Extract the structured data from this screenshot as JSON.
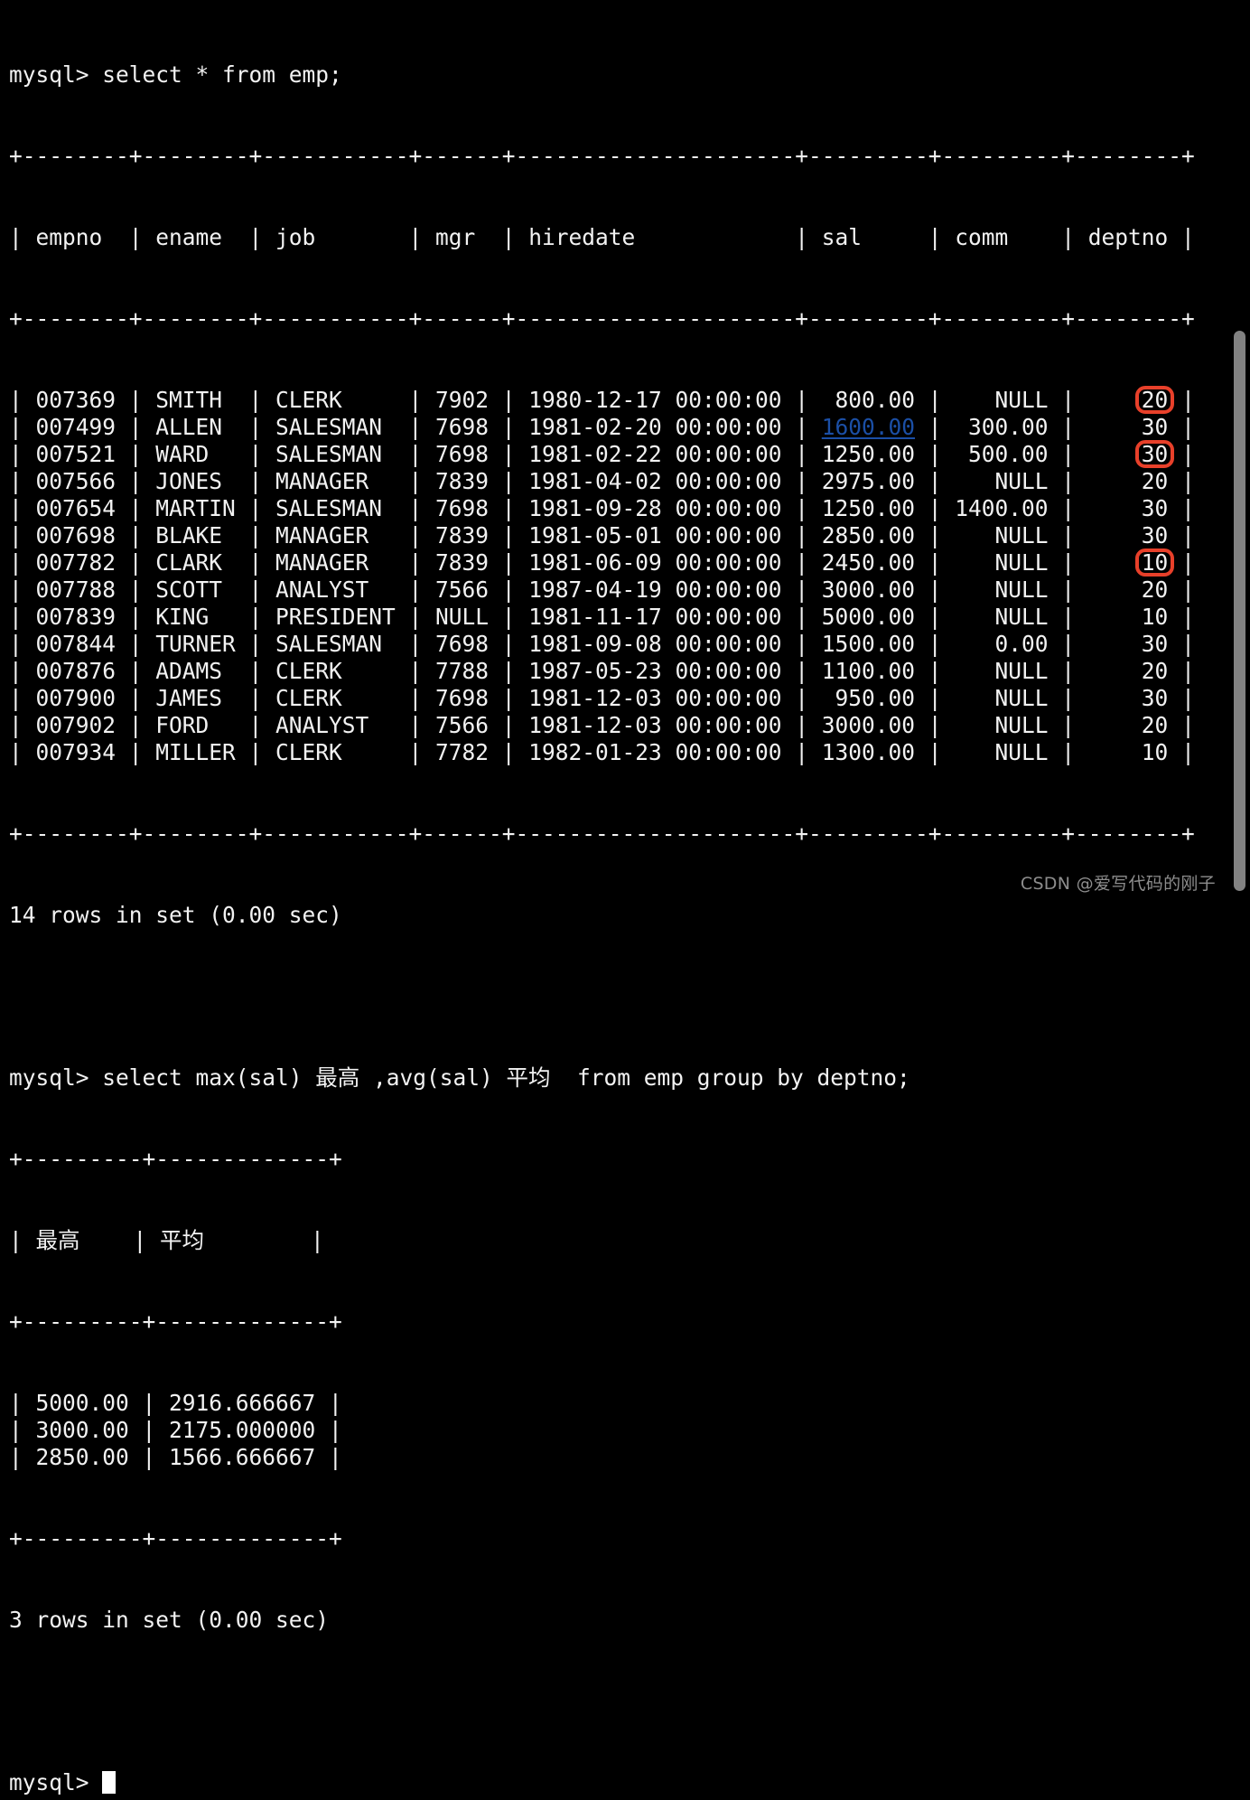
{
  "terminal": {
    "prompt": "mysql>",
    "background_color": "#000000",
    "foreground_color": "#f2f2f2",
    "highlight_color": "#e8402a",
    "link_color": "#1b4fa6",
    "scrollbar_color": "#828282"
  },
  "command_1": "mysql> select * from emp;",
  "table_1": {
    "separator": "+--------+--------+-----------+------+---------------------+---------+---------+--------+",
    "headers": [
      "empno",
      "ename",
      "job",
      "mgr",
      "hiredate",
      "sal",
      "comm",
      "deptno"
    ],
    "header_line": "| empno  | ename  | job       | mgr  | hiredate            | sal     | comm    | deptno |",
    "rows": [
      {
        "empno": "007369",
        "ename": "SMITH",
        "job": "CLERK",
        "mgr": "7902",
        "hiredate": "1980-12-17 00:00:00",
        "sal": " 800.00",
        "comm": "   NULL",
        "deptno": "20",
        "sal_link": false,
        "deptno_boxed": true
      },
      {
        "empno": "007499",
        "ename": "ALLEN",
        "job": "SALESMAN",
        "mgr": "7698",
        "hiredate": "1981-02-20 00:00:00",
        "sal": "1600.00",
        "comm": " 300.00",
        "deptno": "30",
        "sal_link": true,
        "deptno_boxed": false
      },
      {
        "empno": "007521",
        "ename": "WARD",
        "job": "SALESMAN",
        "mgr": "7698",
        "hiredate": "1981-02-22 00:00:00",
        "sal": "1250.00",
        "comm": " 500.00",
        "deptno": "30",
        "sal_link": false,
        "deptno_boxed": true
      },
      {
        "empno": "007566",
        "ename": "JONES",
        "job": "MANAGER",
        "mgr": "7839",
        "hiredate": "1981-04-02 00:00:00",
        "sal": "2975.00",
        "comm": "   NULL",
        "deptno": "20",
        "sal_link": false,
        "deptno_boxed": false
      },
      {
        "empno": "007654",
        "ename": "MARTIN",
        "job": "SALESMAN",
        "mgr": "7698",
        "hiredate": "1981-09-28 00:00:00",
        "sal": "1250.00",
        "comm": "1400.00",
        "deptno": "30",
        "sal_link": false,
        "deptno_boxed": false
      },
      {
        "empno": "007698",
        "ename": "BLAKE",
        "job": "MANAGER",
        "mgr": "7839",
        "hiredate": "1981-05-01 00:00:00",
        "sal": "2850.00",
        "comm": "   NULL",
        "deptno": "30",
        "sal_link": false,
        "deptno_boxed": false
      },
      {
        "empno": "007782",
        "ename": "CLARK",
        "job": "MANAGER",
        "mgr": "7839",
        "hiredate": "1981-06-09 00:00:00",
        "sal": "2450.00",
        "comm": "   NULL",
        "deptno": "10",
        "sal_link": false,
        "deptno_boxed": true
      },
      {
        "empno": "007788",
        "ename": "SCOTT",
        "job": "ANALYST",
        "mgr": "7566",
        "hiredate": "1987-04-19 00:00:00",
        "sal": "3000.00",
        "comm": "   NULL",
        "deptno": "20",
        "sal_link": false,
        "deptno_boxed": false
      },
      {
        "empno": "007839",
        "ename": "KING",
        "job": "PRESIDENT",
        "mgr": "NULL",
        "hiredate": "1981-11-17 00:00:00",
        "sal": "5000.00",
        "comm": "   NULL",
        "deptno": "10",
        "sal_link": false,
        "deptno_boxed": false
      },
      {
        "empno": "007844",
        "ename": "TURNER",
        "job": "SALESMAN",
        "mgr": "7698",
        "hiredate": "1981-09-08 00:00:00",
        "sal": "1500.00",
        "comm": "   0.00",
        "deptno": "30",
        "sal_link": false,
        "deptno_boxed": false
      },
      {
        "empno": "007876",
        "ename": "ADAMS",
        "job": "CLERK",
        "mgr": "7788",
        "hiredate": "1987-05-23 00:00:00",
        "sal": "1100.00",
        "comm": "   NULL",
        "deptno": "20",
        "sal_link": false,
        "deptno_boxed": false
      },
      {
        "empno": "007900",
        "ename": "JAMES",
        "job": "CLERK",
        "mgr": "7698",
        "hiredate": "1981-12-03 00:00:00",
        "sal": " 950.00",
        "comm": "   NULL",
        "deptno": "30",
        "sal_link": false,
        "deptno_boxed": false
      },
      {
        "empno": "007902",
        "ename": "FORD",
        "job": "ANALYST",
        "mgr": "7566",
        "hiredate": "1981-12-03 00:00:00",
        "sal": "3000.00",
        "comm": "   NULL",
        "deptno": "20",
        "sal_link": false,
        "deptno_boxed": false
      },
      {
        "empno": "007934",
        "ename": "MILLER",
        "job": "CLERK",
        "mgr": "7782",
        "hiredate": "1982-01-23 00:00:00",
        "sal": "1300.00",
        "comm": "   NULL",
        "deptno": "10",
        "sal_link": false,
        "deptno_boxed": false
      }
    ],
    "result_status": "14 rows in set (0.00 sec)"
  },
  "command_2": "mysql> select max(sal) 最高 ,avg(sal) 平均  from emp group by deptno;",
  "table_2": {
    "separator": "+---------+-------------+",
    "headers": [
      "最高",
      "平均"
    ],
    "header_line": "| 最高    | 平均        |",
    "rows": [
      {
        "max": "5000.00",
        "avg": "2916.666667"
      },
      {
        "max": "3000.00",
        "avg": "2175.000000"
      },
      {
        "max": "2850.00",
        "avg": "1566.666667"
      }
    ],
    "result_status": "3 rows in set (0.00 sec)"
  },
  "final_prompt": "mysql> ",
  "watermark": "CSDN @爱写代码的刚子",
  "annotations": {
    "boxed_deptno_values": [
      "20",
      "30",
      "10"
    ],
    "linked_sal_value": "1600.00"
  }
}
